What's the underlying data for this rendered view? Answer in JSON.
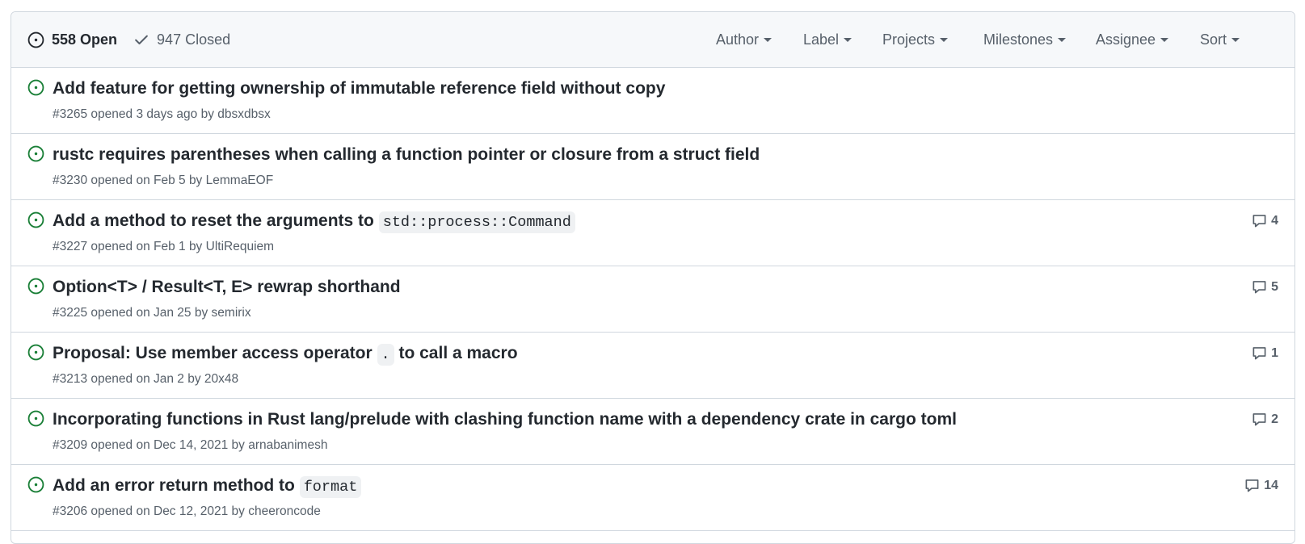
{
  "header": {
    "open_count": "558 Open",
    "closed_count": "947 Closed",
    "filters": [
      "Author",
      "Label",
      "Projects",
      "Milestones",
      "Assignee",
      "Sort"
    ]
  },
  "issues": [
    {
      "title_parts": [
        "Add feature for getting ownership of immutable reference field without copy"
      ],
      "code": "",
      "title_after": "",
      "number": "#3265",
      "opened_text": "opened 3 days ago by",
      "author": "dbsxdbsx",
      "comments": ""
    },
    {
      "title_parts": [
        "rustc requires parentheses when calling a function pointer or closure from a struct field"
      ],
      "code": "",
      "title_after": "",
      "number": "#3230",
      "opened_text": "opened on Feb 5 by",
      "author": "LemmaEOF",
      "comments": ""
    },
    {
      "title_parts": [
        "Add a method to reset the arguments to"
      ],
      "code": "std::process::Command",
      "title_after": "",
      "number": "#3227",
      "opened_text": "opened on Feb 1 by",
      "author": "UltiRequiem",
      "comments": "4"
    },
    {
      "title_parts": [
        "Option<T> / Result<T, E> rewrap shorthand"
      ],
      "code": "",
      "title_after": "",
      "number": "#3225",
      "opened_text": "opened on Jan 25 by",
      "author": "semirix",
      "comments": "5"
    },
    {
      "title_parts": [
        "Proposal: Use member access operator"
      ],
      "code": ".",
      "title_after": "to call a macro",
      "number": "#3213",
      "opened_text": "opened on Jan 2 by",
      "author": "20x48",
      "comments": "1"
    },
    {
      "title_parts": [
        "Incorporating functions in Rust lang/prelude with clashing function name with a dependency crate in cargo toml"
      ],
      "code": "",
      "title_after": "",
      "number": "#3209",
      "opened_text": "opened on Dec 14, 2021 by",
      "author": "arnabanimesh",
      "comments": "2"
    },
    {
      "title_parts": [
        "Add an error return method to"
      ],
      "code": "format",
      "title_after": "",
      "number": "#3206",
      "opened_text": "opened on Dec 12, 2021 by",
      "author": "cheeroncode",
      "comments": "14"
    }
  ],
  "colors": {
    "open_green": "#1a7f37",
    "muted": "#57606a",
    "border": "#d0d7de",
    "header_bg": "#f6f8fa"
  },
  "icons": {
    "open_state": "issue-opened-icon",
    "closed_state": "check-icon",
    "issue": "issue-opened-icon",
    "comment": "comment-icon"
  }
}
